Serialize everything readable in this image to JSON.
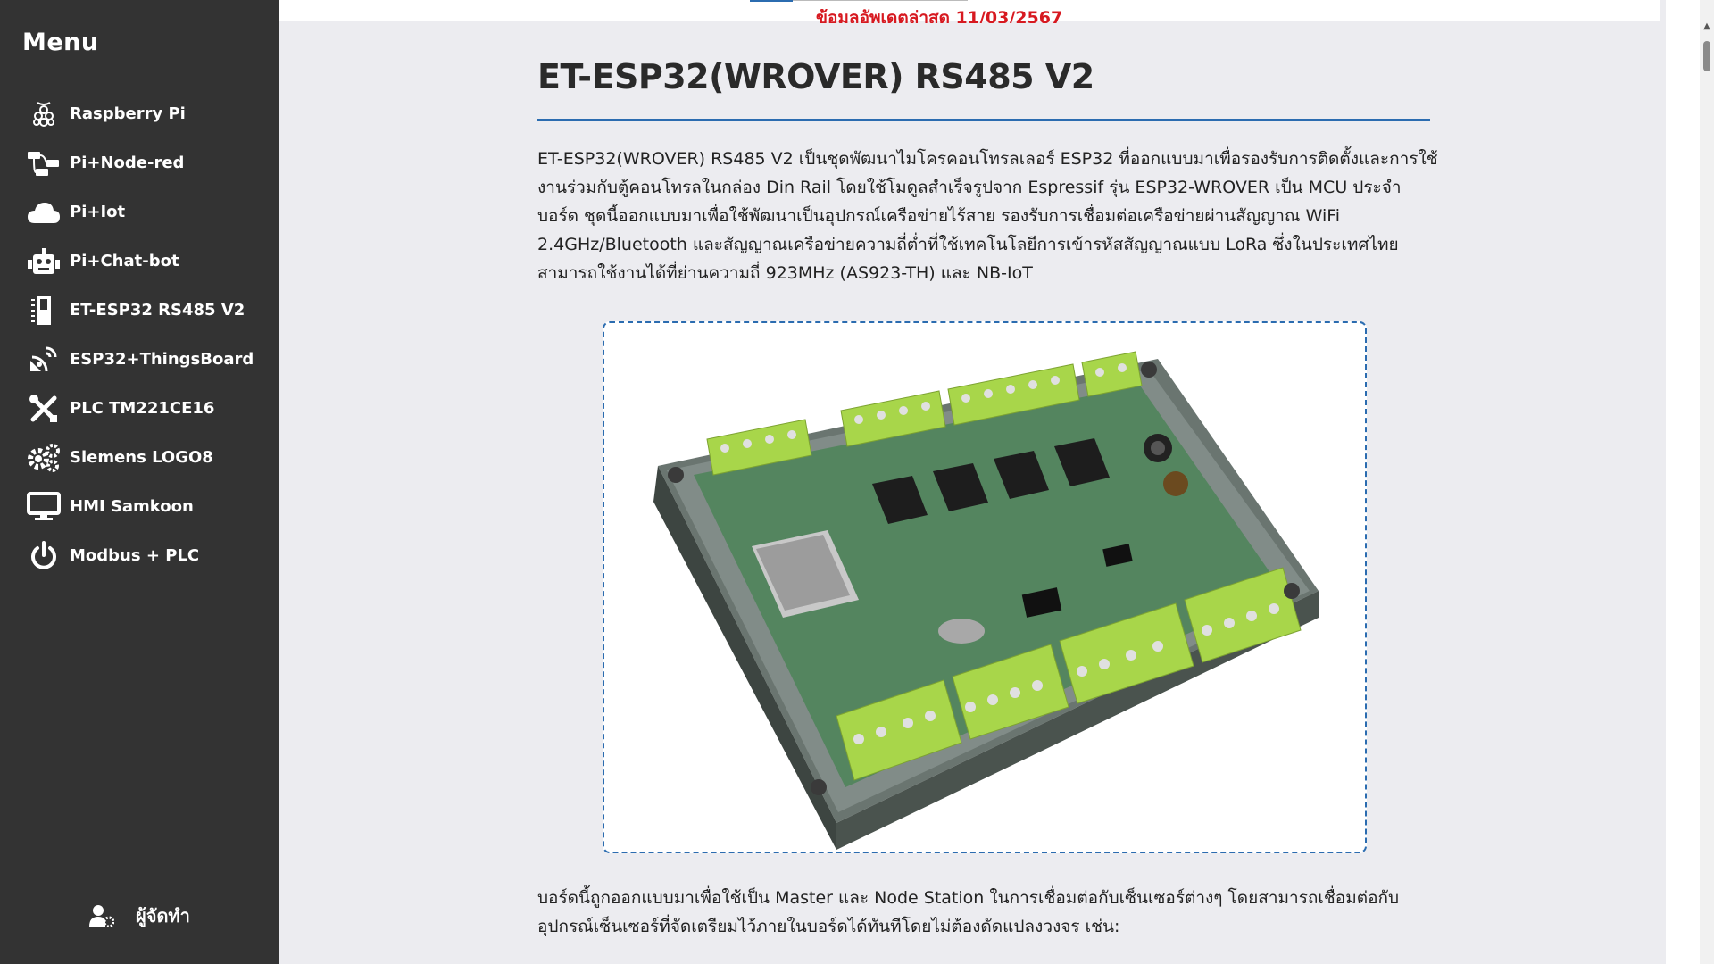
{
  "sidebar": {
    "title": "Menu",
    "items": [
      {
        "label": "Raspberry Pi",
        "icon": "raspberry-icon"
      },
      {
        "label": "Pi+Node-red",
        "icon": "node-red-icon"
      },
      {
        "label": "Pi+Iot",
        "icon": "cloud-icon"
      },
      {
        "label": "Pi+Chat-bot",
        "icon": "robot-icon"
      },
      {
        "label": "ET-ESP32 RS485 V2",
        "icon": "sd-card-icon"
      },
      {
        "label": "ESP32+ThingsBoard",
        "icon": "satellite-dish-icon"
      },
      {
        "label": "PLC TM221CE16",
        "icon": "tools-icon"
      },
      {
        "label": "Siemens LOGO8",
        "icon": "gears-icon"
      },
      {
        "label": "HMI Samkoon",
        "icon": "desktop-icon"
      },
      {
        "label": "Modbus + PLC",
        "icon": "power-icon"
      }
    ],
    "admin_label": "ผู้จัดทำ",
    "admin_icon": "user-gear-icon"
  },
  "page": {
    "updated_text": "ข้อมูลอัพเดตล่าสุด 11/03/2567",
    "title": "ET-ESP32(WROVER) RS485 V2",
    "intro": "ET-ESP32(WROVER) RS485 V2 เป็นชุดพัฒนาไมโครคอนโทรลเลอร์ ESP32 ที่ออกแบบมาเพื่อรองรับการติดตั้งและการใช้งานร่วมกับตู้คอนโทรลในกล่อง Din Rail โดยใช้โมดูลสำเร็จรูปจาก Espressif รุ่น ESP32-WROVER เป็น MCU ประจำบอร์ด ชุดนี้ออกแบบมาเพื่อใช้พัฒนาเป็นอุปกรณ์เครือข่ายไร้สาย รองรับการเชื่อมต่อเครือข่ายผ่านสัญญาณ WiFi 2.4GHz/Bluetooth และสัญญาณเครือข่ายความถี่ต่ำที่ใช้เทคโนโลยีการเข้ารหัสสัญญาณแบบ LoRa ซึ่งในประเทศไทยสามารถใช้งานได้ที่ย่านความถี่ 923MHz (AS923-TH) และ NB-IoT",
    "body2": "บอร์ดนี้ถูกออกแบบมาเพื่อใช้เป็น Master และ Node Station ในการเชื่อมต่อกับเซ็นเซอร์ต่างๆ โดยสามารถเชื่อมต่อกับอุปกรณ์เซ็นเซอร์ที่จัดเตรียมไว้ภายในบอร์ดได้ทันทีโดยไม่ต้องดัดแปลงวงจร เช่น:"
  },
  "colors": {
    "sidebar_bg": "#333333",
    "accent": "#2b6cb0",
    "updated": "#d71920",
    "terminal_green": "#a8d64a",
    "pcb_green": "#2e6b3a"
  }
}
